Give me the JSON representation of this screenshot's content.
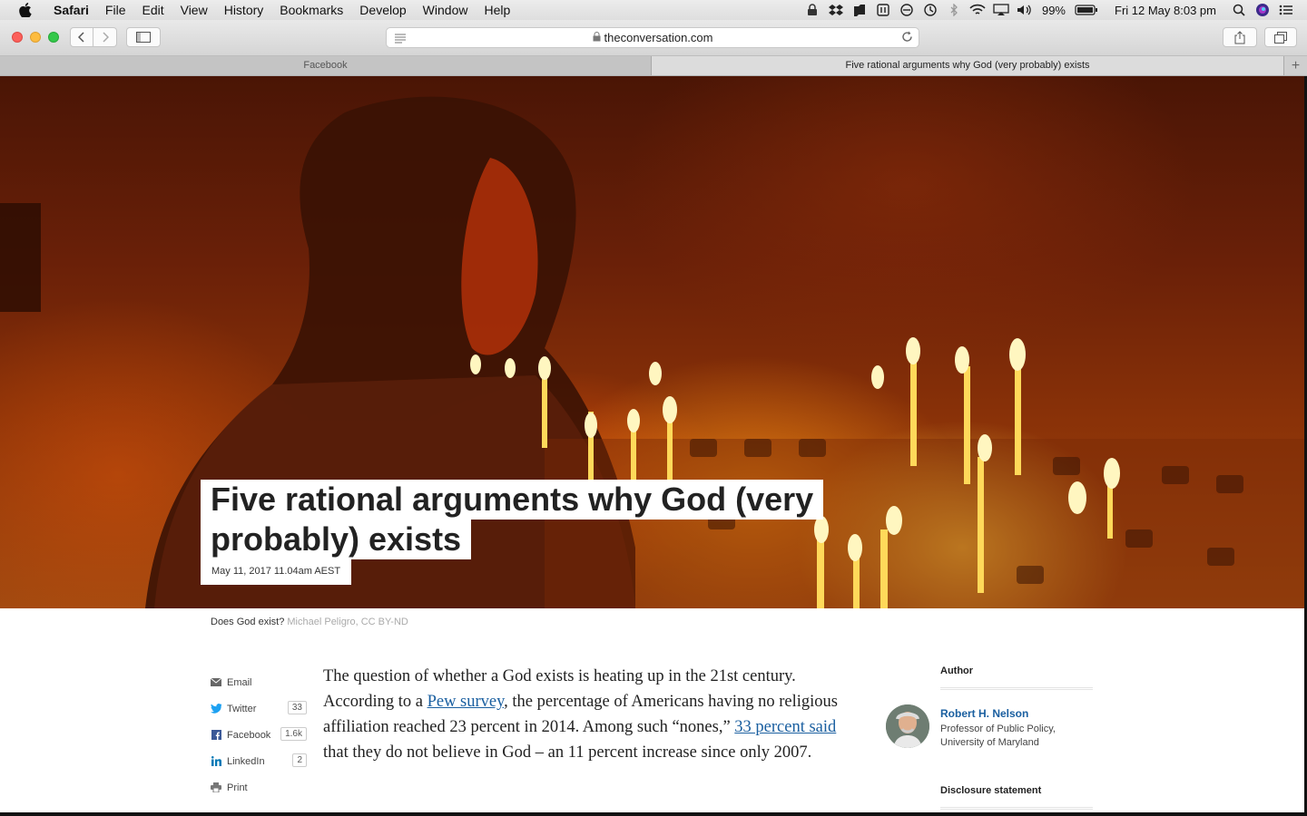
{
  "menubar": {
    "app": "Safari",
    "items": [
      "File",
      "Edit",
      "View",
      "History",
      "Bookmarks",
      "Develop",
      "Window",
      "Help"
    ],
    "battery": "99%",
    "datetime": "Fri 12 May  8:03 pm"
  },
  "browser": {
    "url": "theconversation.com",
    "tabs": [
      {
        "title": "Facebook",
        "active": false
      },
      {
        "title": "Five rational arguments why God (very probably) exists",
        "active": true
      }
    ],
    "new_tab_label": "+"
  },
  "article": {
    "headline_line1": "Five rational arguments why God (very",
    "headline_line2": "probably) exists",
    "dateline": "May 11, 2017 11.04am AEST",
    "caption": "Does God exist?",
    "caption_credit": "Michael Peligro, CC BY-ND",
    "body": {
      "t1": "The question of whether a God exists is heating up in the 21st century. According to a ",
      "link1": "Pew survey",
      "t2": ", the percentage of Americans having no reli­gious affiliation reached 23 percent in 2014. Among such “nones,” ",
      "link2": "33 percent said",
      "t3": " that they do not believe in God – an 11 percent increase since only 2007."
    }
  },
  "share": [
    {
      "label": "Email",
      "icon": "email-icon",
      "count": ""
    },
    {
      "label": "Twitter",
      "icon": "twitter-icon",
      "count": "33"
    },
    {
      "label": "Facebook",
      "icon": "facebook-icon",
      "count": "1.6k"
    },
    {
      "label": "LinkedIn",
      "icon": "linkedin-icon",
      "count": "2"
    },
    {
      "label": "Print",
      "icon": "print-icon",
      "count": ""
    }
  ],
  "sidebar": {
    "author_heading": "Author",
    "author_name": "Robert H. Nelson",
    "author_role": "Professor of Public Policy, University of Maryland",
    "disclosure_heading": "Disclosure statement"
  },
  "colors": {
    "link": "#1a5fa0",
    "twitter": "#1da1f2",
    "facebook": "#3b5998",
    "linkedin": "#0077b5"
  }
}
